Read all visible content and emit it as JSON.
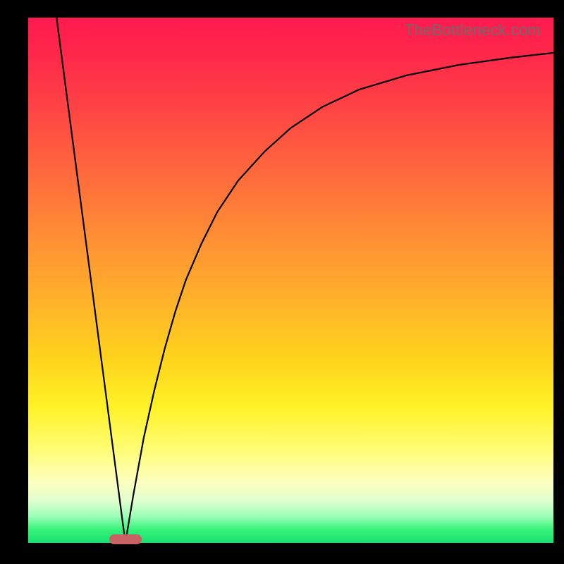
{
  "watermark": "TheBottleneck.com",
  "chart_data": {
    "type": "line",
    "title": "",
    "xlabel": "",
    "ylabel": "",
    "xlim": [
      0,
      100
    ],
    "ylim": [
      0,
      100
    ],
    "grid": false,
    "note": "Axes are unlabeled; values are normalized 0–100 estimates read from pixel positions.",
    "series": [
      {
        "name": "left-descending-line",
        "x": [
          5.4,
          18.5
        ],
        "y": [
          100,
          0
        ]
      },
      {
        "name": "right-asymptotic-curve",
        "x": [
          18.5,
          20,
          22,
          24,
          26,
          28,
          30,
          33,
          36,
          40,
          45,
          50,
          56,
          63,
          72,
          82,
          92,
          100
        ],
        "y": [
          0,
          9,
          20,
          29,
          37,
          44,
          50,
          57,
          63,
          69,
          74.5,
          79,
          83,
          86.3,
          89,
          91,
          92.4,
          93.3
        ]
      }
    ],
    "bottleneck_marker": {
      "x_range": [
        15.4,
        21.6
      ],
      "y": 0,
      "color": "#c96263"
    },
    "background_gradient": {
      "direction": "top-to-bottom",
      "stops": [
        {
          "pos": 0.0,
          "color": "#ff1a4e"
        },
        {
          "pos": 0.3,
          "color": "#ff6a3c"
        },
        {
          "pos": 0.55,
          "color": "#ffb22a"
        },
        {
          "pos": 0.74,
          "color": "#fff226"
        },
        {
          "pos": 0.92,
          "color": "#e2ffcf"
        },
        {
          "pos": 1.0,
          "color": "#17e070"
        }
      ]
    }
  }
}
